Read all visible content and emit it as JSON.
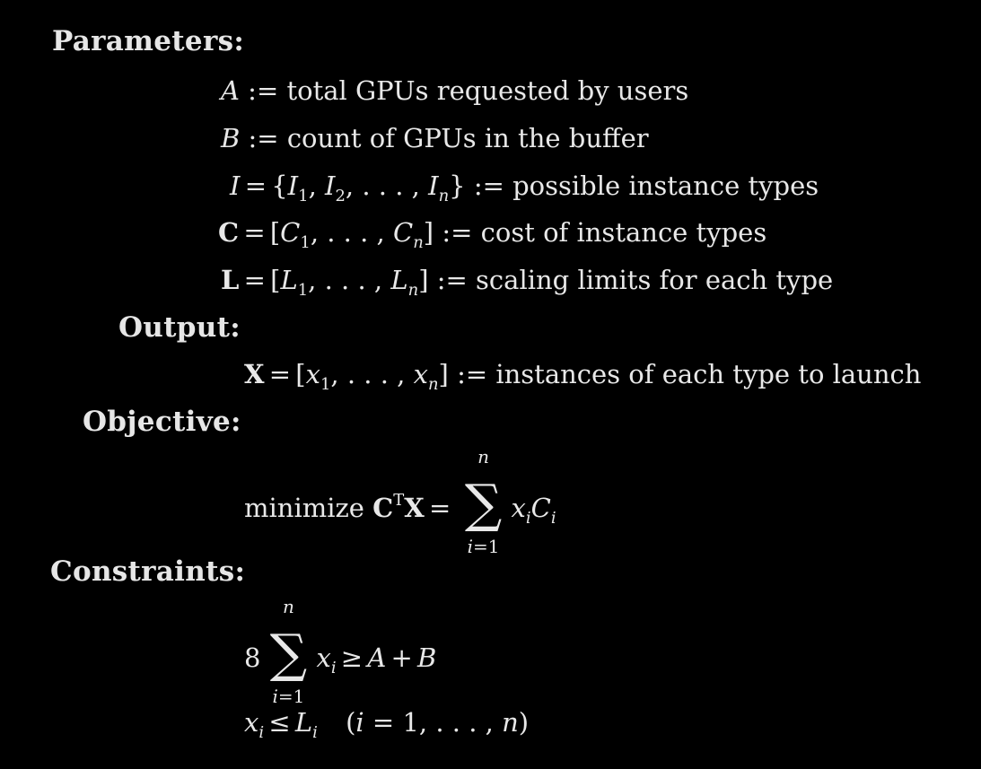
{
  "parameters": {
    "heading": "Parameters:",
    "A": {
      "sym": "A",
      "def": ":= total GPUs requested by users"
    },
    "B": {
      "sym": "B",
      "def": ":= count of GPUs in the buffer"
    },
    "I": {
      "sym": "I",
      "def": ":= possible instance types"
    },
    "C": {
      "sym": "C",
      "def": ":= cost of instance types"
    },
    "L": {
      "sym": "L",
      "def": ":= scaling limits for each type"
    }
  },
  "output": {
    "heading": "Output:",
    "X": {
      "sym": "X",
      "def": ":= instances of each type to launch"
    }
  },
  "objective": {
    "heading": "Objective:",
    "keyword": "minimize",
    "sum_upper": "n",
    "sum_lower": "i=1"
  },
  "constraints": {
    "heading": "Constraints:",
    "coefficient": "8",
    "sum_upper": "n",
    "sum_lower": "i=1",
    "range": "(i = 1, . . . , n)"
  }
}
